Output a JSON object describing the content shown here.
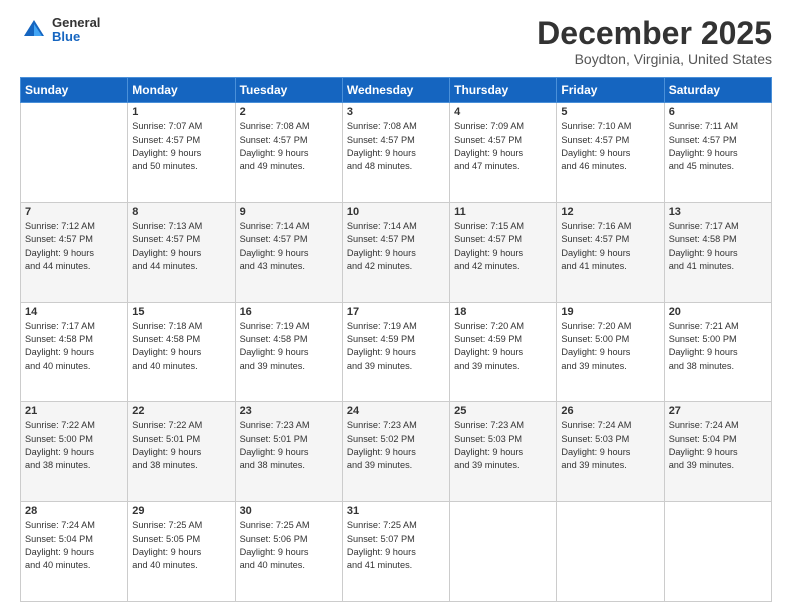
{
  "logo": {
    "general": "General",
    "blue": "Blue"
  },
  "header": {
    "month": "December 2025",
    "location": "Boydton, Virginia, United States"
  },
  "days_of_week": [
    "Sunday",
    "Monday",
    "Tuesday",
    "Wednesday",
    "Thursday",
    "Friday",
    "Saturday"
  ],
  "weeks": [
    [
      {
        "day": "",
        "info": ""
      },
      {
        "day": "1",
        "info": "Sunrise: 7:07 AM\nSunset: 4:57 PM\nDaylight: 9 hours\nand 50 minutes."
      },
      {
        "day": "2",
        "info": "Sunrise: 7:08 AM\nSunset: 4:57 PM\nDaylight: 9 hours\nand 49 minutes."
      },
      {
        "day": "3",
        "info": "Sunrise: 7:08 AM\nSunset: 4:57 PM\nDaylight: 9 hours\nand 48 minutes."
      },
      {
        "day": "4",
        "info": "Sunrise: 7:09 AM\nSunset: 4:57 PM\nDaylight: 9 hours\nand 47 minutes."
      },
      {
        "day": "5",
        "info": "Sunrise: 7:10 AM\nSunset: 4:57 PM\nDaylight: 9 hours\nand 46 minutes."
      },
      {
        "day": "6",
        "info": "Sunrise: 7:11 AM\nSunset: 4:57 PM\nDaylight: 9 hours\nand 45 minutes."
      }
    ],
    [
      {
        "day": "7",
        "info": "Sunrise: 7:12 AM\nSunset: 4:57 PM\nDaylight: 9 hours\nand 44 minutes."
      },
      {
        "day": "8",
        "info": "Sunrise: 7:13 AM\nSunset: 4:57 PM\nDaylight: 9 hours\nand 44 minutes."
      },
      {
        "day": "9",
        "info": "Sunrise: 7:14 AM\nSunset: 4:57 PM\nDaylight: 9 hours\nand 43 minutes."
      },
      {
        "day": "10",
        "info": "Sunrise: 7:14 AM\nSunset: 4:57 PM\nDaylight: 9 hours\nand 42 minutes."
      },
      {
        "day": "11",
        "info": "Sunrise: 7:15 AM\nSunset: 4:57 PM\nDaylight: 9 hours\nand 42 minutes."
      },
      {
        "day": "12",
        "info": "Sunrise: 7:16 AM\nSunset: 4:57 PM\nDaylight: 9 hours\nand 41 minutes."
      },
      {
        "day": "13",
        "info": "Sunrise: 7:17 AM\nSunset: 4:58 PM\nDaylight: 9 hours\nand 41 minutes."
      }
    ],
    [
      {
        "day": "14",
        "info": "Sunrise: 7:17 AM\nSunset: 4:58 PM\nDaylight: 9 hours\nand 40 minutes."
      },
      {
        "day": "15",
        "info": "Sunrise: 7:18 AM\nSunset: 4:58 PM\nDaylight: 9 hours\nand 40 minutes."
      },
      {
        "day": "16",
        "info": "Sunrise: 7:19 AM\nSunset: 4:58 PM\nDaylight: 9 hours\nand 39 minutes."
      },
      {
        "day": "17",
        "info": "Sunrise: 7:19 AM\nSunset: 4:59 PM\nDaylight: 9 hours\nand 39 minutes."
      },
      {
        "day": "18",
        "info": "Sunrise: 7:20 AM\nSunset: 4:59 PM\nDaylight: 9 hours\nand 39 minutes."
      },
      {
        "day": "19",
        "info": "Sunrise: 7:20 AM\nSunset: 5:00 PM\nDaylight: 9 hours\nand 39 minutes."
      },
      {
        "day": "20",
        "info": "Sunrise: 7:21 AM\nSunset: 5:00 PM\nDaylight: 9 hours\nand 38 minutes."
      }
    ],
    [
      {
        "day": "21",
        "info": "Sunrise: 7:22 AM\nSunset: 5:00 PM\nDaylight: 9 hours\nand 38 minutes."
      },
      {
        "day": "22",
        "info": "Sunrise: 7:22 AM\nSunset: 5:01 PM\nDaylight: 9 hours\nand 38 minutes."
      },
      {
        "day": "23",
        "info": "Sunrise: 7:23 AM\nSunset: 5:01 PM\nDaylight: 9 hours\nand 38 minutes."
      },
      {
        "day": "24",
        "info": "Sunrise: 7:23 AM\nSunset: 5:02 PM\nDaylight: 9 hours\nand 39 minutes."
      },
      {
        "day": "25",
        "info": "Sunrise: 7:23 AM\nSunset: 5:03 PM\nDaylight: 9 hours\nand 39 minutes."
      },
      {
        "day": "26",
        "info": "Sunrise: 7:24 AM\nSunset: 5:03 PM\nDaylight: 9 hours\nand 39 minutes."
      },
      {
        "day": "27",
        "info": "Sunrise: 7:24 AM\nSunset: 5:04 PM\nDaylight: 9 hours\nand 39 minutes."
      }
    ],
    [
      {
        "day": "28",
        "info": "Sunrise: 7:24 AM\nSunset: 5:04 PM\nDaylight: 9 hours\nand 40 minutes."
      },
      {
        "day": "29",
        "info": "Sunrise: 7:25 AM\nSunset: 5:05 PM\nDaylight: 9 hours\nand 40 minutes."
      },
      {
        "day": "30",
        "info": "Sunrise: 7:25 AM\nSunset: 5:06 PM\nDaylight: 9 hours\nand 40 minutes."
      },
      {
        "day": "31",
        "info": "Sunrise: 7:25 AM\nSunset: 5:07 PM\nDaylight: 9 hours\nand 41 minutes."
      },
      {
        "day": "",
        "info": ""
      },
      {
        "day": "",
        "info": ""
      },
      {
        "day": "",
        "info": ""
      }
    ]
  ]
}
